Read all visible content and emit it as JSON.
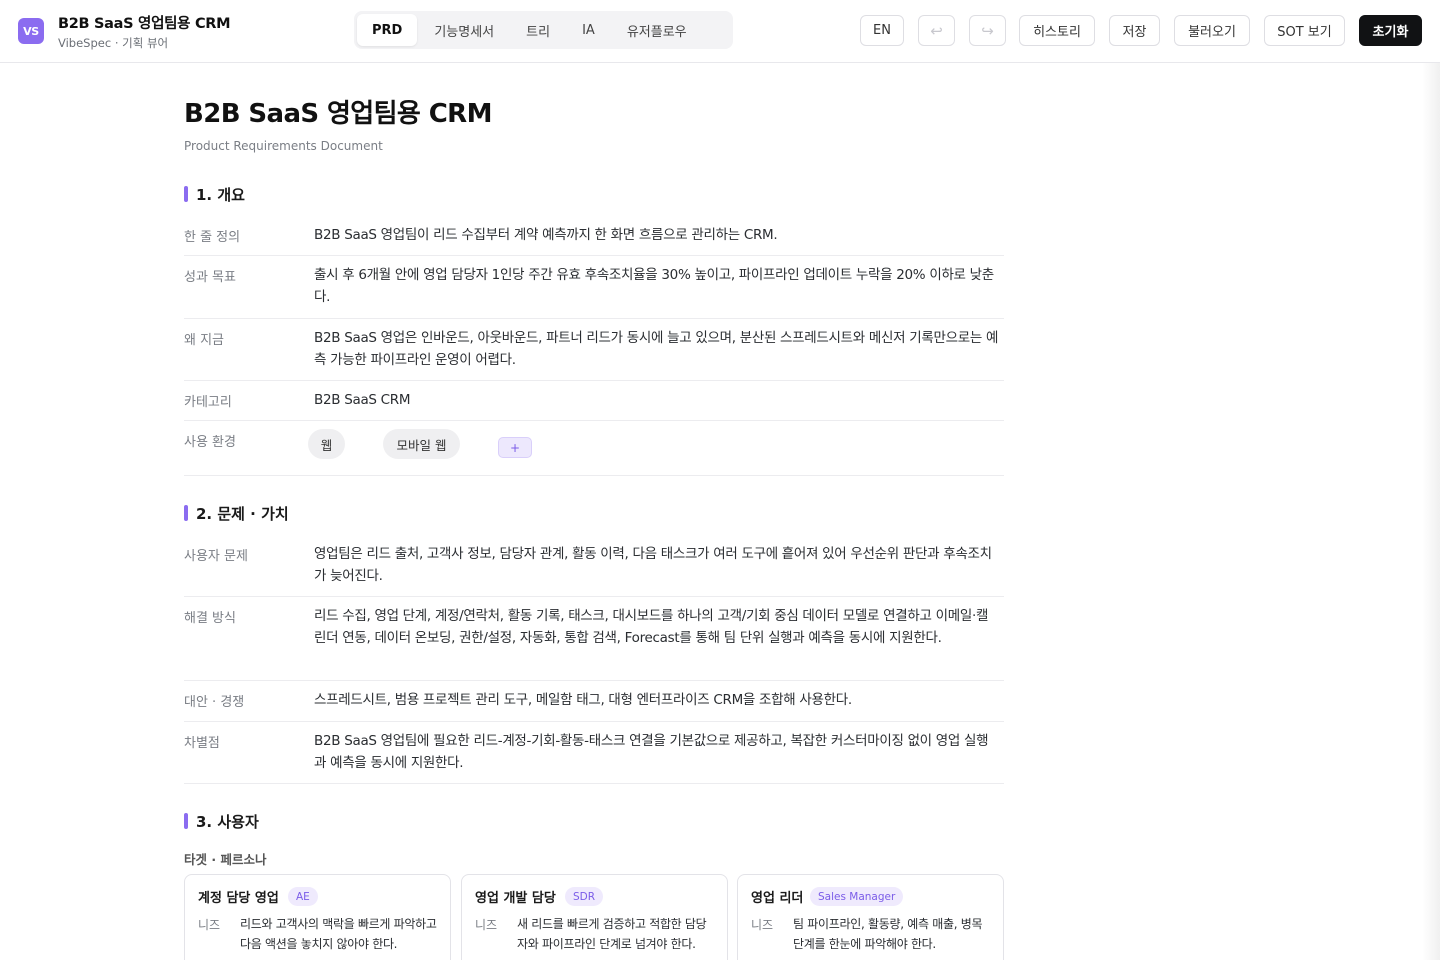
{
  "header": {
    "logo_text": "VS",
    "title": "B2B SaaS 영업팀용 CRM",
    "subtitle": "VibeSpec · 기획 뷰어",
    "tabs": [
      {
        "label": "PRD",
        "active": true
      },
      {
        "label": "기능명세서",
        "active": false
      },
      {
        "label": "트리",
        "active": false
      },
      {
        "label": "IA",
        "active": false
      },
      {
        "label": "유저플로우",
        "active": false
      }
    ],
    "lang_label": "EN",
    "undo_glyph": "↩",
    "redo_glyph": "↪",
    "history_label": "히스토리",
    "save_label": "저장",
    "load_label": "불러오기",
    "sot_label": "SOT 보기",
    "reset_label": "초기화"
  },
  "doc": {
    "title": "B2B SaaS 영업팀용 CRM",
    "subtitle": "Product Requirements Document",
    "sections": [
      {
        "heading": "1. 개요",
        "rows": [
          {
            "label": "한 줄 정의",
            "value": "B2B SaaS 영업팀이 리드 수집부터 계약 예측까지 한 화면 흐름으로 관리하는 CRM."
          },
          {
            "label": "성과 목표",
            "value": "출시 후 6개월 안에 영업 담당자 1인당 주간 유효 후속조치율을 30% 높이고, 파이프라인 업데이트 누락을 20% 이하로 낮춘다."
          },
          {
            "label": "왜 지금",
            "value": "B2B SaaS 영업은 인바운드, 아웃바운드, 파트너 리드가 동시에 늘고 있으며, 분산된 스프레드시트와 메신저 기록만으로는 예측 가능한 파이프라인 운영이 어렵다."
          },
          {
            "label": "카테고리",
            "value": "B2B SaaS CRM"
          },
          {
            "label": "사용 환경",
            "chips": [
              "웹",
              "모바일 웹"
            ],
            "add_label": "+"
          }
        ]
      },
      {
        "heading": "2. 문제 · 가치",
        "rows": [
          {
            "label": "사용자 문제",
            "value": "영업팀은 리드 출처, 고객사 정보, 담당자 관계, 활동 이력, 다음 태스크가 여러 도구에 흩어져 있어 우선순위 판단과 후속조치가 늦어진다."
          },
          {
            "label": "해결 방식",
            "value": "리드 수집, 영업 단계, 계정/연락처, 활동 기록, 태스크, 대시보드를 하나의 고객/기회 중심 데이터 모델로 연결하고 이메일·캘린더 연동, 데이터 온보딩, 권한/설정, 자동화, 통합 검색, Forecast를 통해 팀 단위 실행과 예측을 동시에 지원한다."
          },
          {
            "label": "대안 · 경쟁",
            "value": "스프레드시트, 범용 프로젝트 관리 도구, 메일함 태그, 대형 엔터프라이즈 CRM을 조합해 사용한다."
          },
          {
            "label": "차별점",
            "value": "B2B SaaS 영업팀에 필요한 리드-계정-기회-활동-태스크 연결을 기본값으로 제공하고, 복잡한 커스터마이징 없이 영업 실행과 예측을 동시에 지원한다."
          }
        ]
      },
      {
        "heading": "3. 사용자",
        "subheading": "타겟 · 페르소나",
        "personas": [
          {
            "name": "계정 담당 영업",
            "tag": "AE",
            "need_label": "니즈",
            "need": "리드와 고객사의 맥락을 빠르게 파악하고 다음 액션을 놓치지 않아야 한다."
          },
          {
            "name": "영업 개발 담당",
            "tag": "SDR",
            "need_label": "니즈",
            "need": "새 리드를 빠르게 검증하고 적합한 담당자와 파이프라인 단계로 넘겨야 한다."
          },
          {
            "name": "영업 리더",
            "tag": "Sales Manager",
            "need_label": "니즈",
            "need": "팀 파이프라인, 활동량, 예측 매출, 병목 단계를 한눈에 파악해야 한다."
          }
        ]
      }
    ]
  }
}
